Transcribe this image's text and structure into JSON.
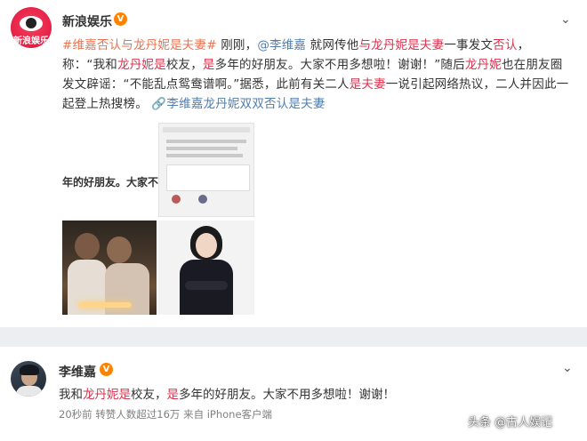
{
  "post1": {
    "account_name": "新浪娱乐",
    "verified_badge": "V",
    "avatar_text": "新浪娱乐",
    "menu_icon": "chevron-down-icon",
    "content": {
      "hashtag1": "#维嘉否认与龙丹妮是夫妻#",
      "t1": " 刚刚，",
      "mention": "@李维嘉",
      "t2": " 就网传他",
      "hl1": "与龙丹妮是夫妻",
      "t3": "一事发文",
      "hl2": "否认",
      "t4": "，称：“我和",
      "hl3": "龙丹妮是",
      "t5": "校友，",
      "hl4": "是",
      "t6": "多年的好朋友。大家不用多想啦！谢谢！”随后",
      "hl5": "龙丹妮",
      "t7": "也在朋友圈发文辟谣：“不能乱点鸳鸯谱啊。”据悉，此前有关二人",
      "hl6": "是夫妻",
      "t8": "一说引起网络热议，二人并因此一起登上热搜榜。",
      "topic_icon": "link-icon",
      "topic": "李维嘉龙丹妮双双否认是夫妻"
    },
    "images": {
      "crop_text": "年的好朋友。大家不用"
    }
  },
  "post2": {
    "account_name": "李维嘉",
    "verified_badge": "V",
    "menu_icon": "chevron-down-icon",
    "content": {
      "t1": "我和",
      "hl1": "龙丹妮是",
      "t2": "校友，",
      "hl2": "是",
      "t3": "多年的好朋友。大家不用多想啦！谢谢！"
    },
    "meta": "20秒前  转赞人数超过16万  来自 iPhone客户端"
  },
  "watermark": "头条 @古人娱记",
  "colors": {
    "orange_link": "#eb7350",
    "blue_link": "#507daf",
    "highlight_red": "#d9344e",
    "verified_orange": "#ff8200",
    "separator": "#eceef1"
  }
}
